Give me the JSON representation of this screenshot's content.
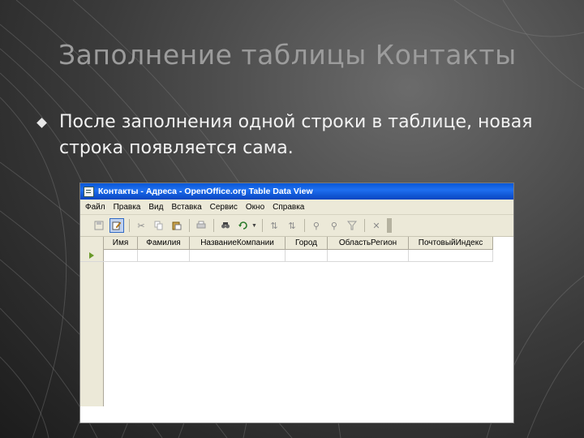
{
  "slide": {
    "title": "Заполнение таблицы Контакты",
    "bullet": "После заполнения одной строки в таблице, новая строка появляется сама."
  },
  "window": {
    "title": "Контакты - Адреса - OpenOffice.org Table Data View",
    "menu": [
      "Файл",
      "Правка",
      "Вид",
      "Вставка",
      "Сервис",
      "Окно",
      "Справка"
    ],
    "toolbar_icons": [
      "save-icon",
      "edit-icon",
      "cut-icon",
      "copy-icon",
      "paste-icon",
      "print-icon",
      "find-icon",
      "refresh-icon",
      "sort-ascending-icon",
      "sort-descending-icon",
      "autofilter-icon",
      "standard-filter-icon",
      "apply-filter-icon",
      "delete-record-icon"
    ],
    "columns": [
      "Имя",
      "Фамилия",
      "НазваниеКомпании",
      "Город",
      "ОбластьРегион",
      "ПочтовыйИндекс"
    ]
  },
  "colors": {
    "titlebar": "#0a58d8",
    "chrome": "#ece9d8",
    "slide_title": "#9c9c9c",
    "slide_text": "#f2f2f2",
    "row_marker": "#6a9a2a"
  }
}
